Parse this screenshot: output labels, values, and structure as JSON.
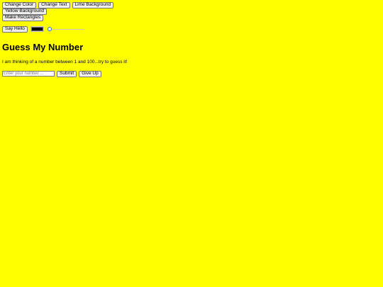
{
  "colors": {
    "page_background": "#ffff00",
    "color_picker_value": "#000000"
  },
  "toolbar": {
    "row1": [
      {
        "label": "Change Color"
      },
      {
        "label": "Change Text"
      },
      {
        "label": "Lime Background"
      }
    ],
    "row2": [
      {
        "label": "Yellow Background"
      }
    ],
    "row3": [
      {
        "label": "Make Rectangles"
      }
    ],
    "say_hello_label": "Say Hello",
    "slider_value": 0
  },
  "game": {
    "title": "Guess My Number",
    "description": "I am thinking of a number between 1 and 100...try to guess it!",
    "input_placeholder": "Enter your number ...",
    "input_value": "",
    "submit_label": "Submit",
    "give_up_label": "Give Up"
  }
}
